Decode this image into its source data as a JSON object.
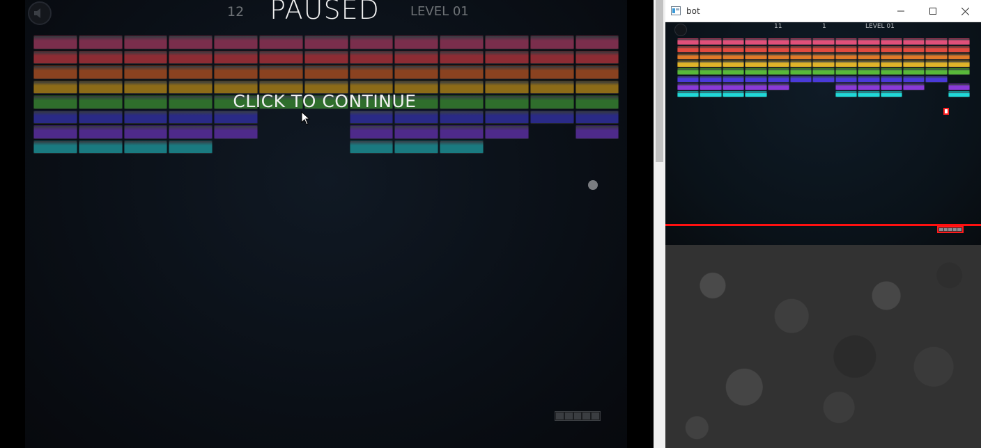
{
  "main_game": {
    "score": "12",
    "status_title": "PAUSED",
    "level": "LEVEL 01",
    "prompt": "CLICK TO CONTINUE",
    "row_colors": [
      "#7a2e4c",
      "#8c2c34",
      "#8a4220",
      "#8c6b18",
      "#2f6e2c",
      "#2a2a86",
      "#4e2a8a",
      "#1a7a80"
    ],
    "missing_bricks": [
      [
        5,
        5
      ],
      [
        5,
        6
      ],
      [
        6,
        6
      ],
      [
        6,
        5
      ],
      [
        6,
        11
      ],
      [
        7,
        4
      ],
      [
        7,
        5
      ],
      [
        7,
        6
      ],
      [
        7,
        10
      ],
      [
        7,
        11
      ],
      [
        7,
        12
      ]
    ],
    "speaker_icon": "speaker-mute-icon",
    "paddle_segments": 5
  },
  "bot_window": {
    "title": "bot",
    "score": "11",
    "lives": "1",
    "level": "LEVEL 01",
    "row_colors": [
      "#e0507a",
      "#e04a40",
      "#e07a28",
      "#e0b42a",
      "#58b83a",
      "#4a3ad8",
      "#8a3ad8",
      "#20d8d8"
    ],
    "missing_bricks": [
      [
        5,
        12
      ],
      [
        6,
        5
      ],
      [
        6,
        6
      ],
      [
        6,
        11
      ],
      [
        7,
        4
      ],
      [
        7,
        5
      ],
      [
        7,
        6
      ],
      [
        7,
        10
      ],
      [
        7,
        11
      ]
    ],
    "detection_color": "#ff1010",
    "paddle_segments": 5
  }
}
